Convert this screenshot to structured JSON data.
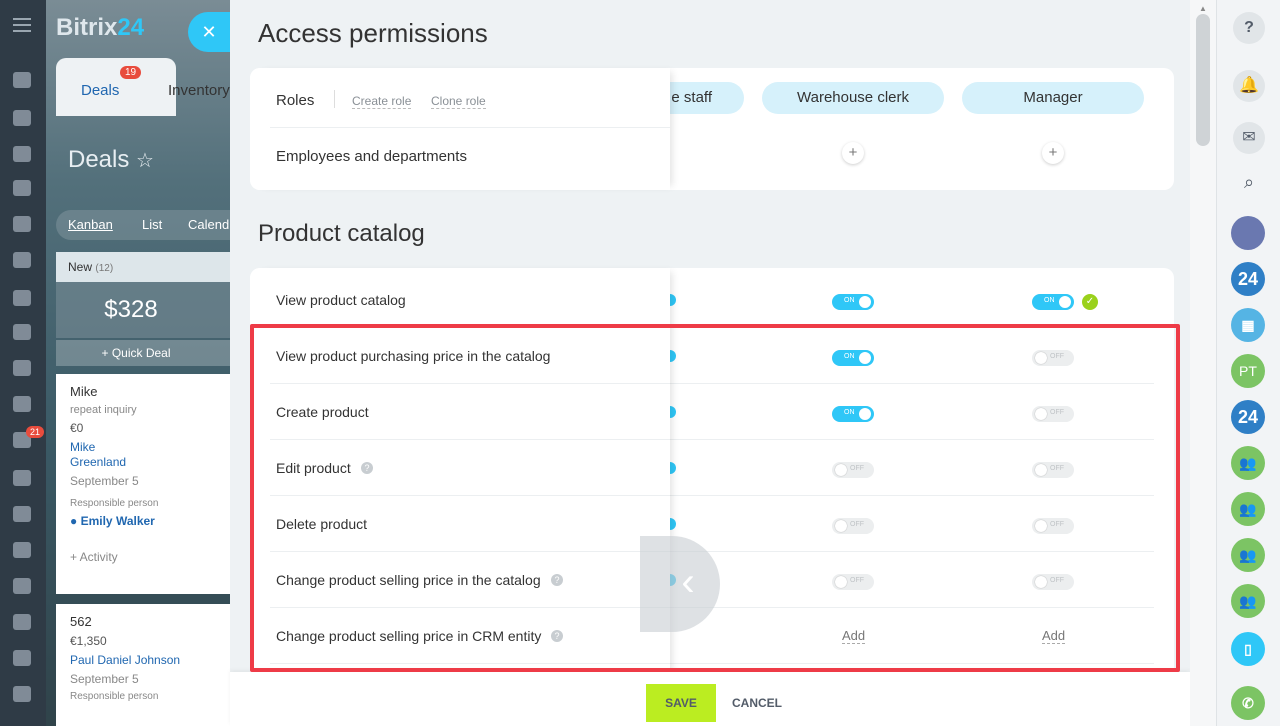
{
  "app": {
    "logo_text": "Bitrix",
    "logo_num": "24"
  },
  "left_nav": {
    "badge_count": "21"
  },
  "crm": {
    "tab_deals": "Deals",
    "tab_deals_badge": "19",
    "tab_inventory": "Inventory",
    "page_title": "Deals",
    "views": [
      "Kanban",
      "List",
      "Calend"
    ],
    "column_name": "New",
    "column_count": "(12)",
    "column_sum": "$328",
    "quick_deal": "+ Quick Deal",
    "card1": {
      "title": "Mike",
      "subtitle": "repeat inquiry",
      "amount": "€0",
      "contact1": "Mike",
      "contact2": "Greenland",
      "date": "September 5",
      "resp_label": "Responsible person",
      "resp_name": "Emily Walker",
      "activity": "+ Activity"
    },
    "card2": {
      "title": "562",
      "amount": "€1,350",
      "contact": "Paul Daniel Johnson",
      "date": "September 5",
      "resp_label": "Responsible person"
    }
  },
  "panel": {
    "title": "Access permissions",
    "roles_label": "Roles",
    "create_role": "Create role",
    "clone_role": "Clone role",
    "role_partial": "e staff",
    "role_warehouse": "Warehouse clerk",
    "role_manager": "Manager",
    "employees_label": "Employees and departments",
    "section_title": "Product catalog",
    "rows": [
      {
        "label": "View product catalog",
        "help": false,
        "col1": "on",
        "col2": "on"
      },
      {
        "label": "View product purchasing price in the catalog",
        "help": false,
        "col1": "on",
        "col2": "off"
      },
      {
        "label": "Create product",
        "help": false,
        "col1": "on",
        "col2": "off"
      },
      {
        "label": "Edit product",
        "help": true,
        "col1": "off",
        "col2": "off"
      },
      {
        "label": "Delete product",
        "help": false,
        "col1": "off",
        "col2": "off"
      },
      {
        "label": "Change product selling price in the catalog",
        "help": true,
        "col1": "off",
        "col2": "off"
      },
      {
        "label": "Change product selling price in CRM entity",
        "help": true,
        "col1": "add",
        "col2": "add"
      }
    ],
    "toggle_on_text": "ON",
    "toggle_off_text": "OFF",
    "add_text": "Add",
    "save_label": "SAVE",
    "cancel_label": "CANCEL"
  },
  "right_bar": {
    "avatar_initials": "PT",
    "b24": "24"
  }
}
